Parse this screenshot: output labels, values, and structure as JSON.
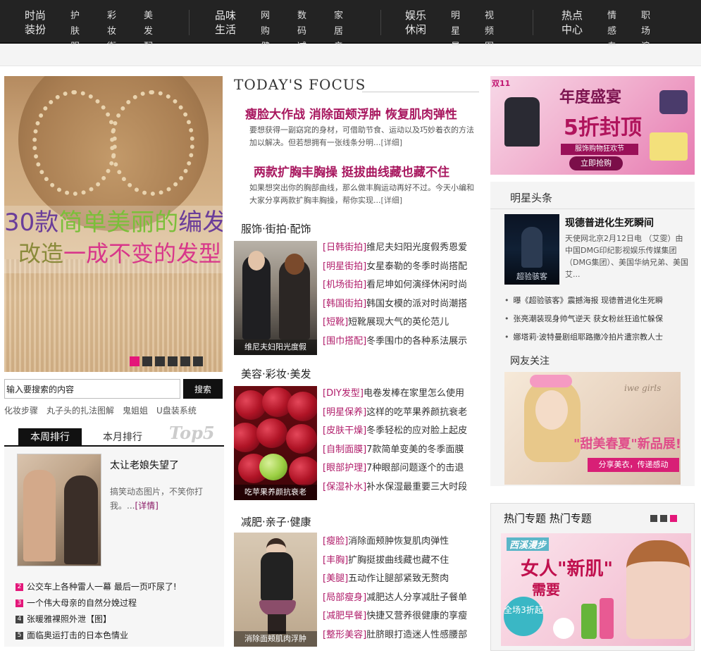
{
  "nav": [
    {
      "cat": [
        "时尚",
        "装扮"
      ],
      "subs": [
        [
          "护肤",
          "服饰"
        ],
        [
          "彩妆",
          "街拍"
        ],
        [
          "美发",
          "配饰"
        ]
      ]
    },
    {
      "cat": [
        "品味",
        "生活"
      ],
      "subs": [
        [
          "网购",
          "健康"
        ],
        [
          "数码",
          "减肥"
        ],
        [
          "家居",
          "亲子"
        ]
      ]
    },
    {
      "cat": [
        "娱乐",
        "休闲"
      ],
      "subs": [
        [
          "明星",
          "星座"
        ],
        [
          "视频",
          "图库"
        ]
      ]
    },
    {
      "cat": [
        "热点",
        "中心"
      ],
      "subs": [
        [
          "情感",
          "专题"
        ],
        [
          "职场",
          "浪漫"
        ]
      ]
    }
  ],
  "hero": {
    "line1": [
      "30款",
      "简单美丽的",
      "编发"
    ],
    "line2": [
      "改造",
      "一成不变的发型"
    ],
    "dots_count": 6,
    "active_dot": 0
  },
  "search": {
    "value": "输入要搜索的内容",
    "button": "搜索"
  },
  "hotwords": [
    "化妆步骤",
    "丸子头的扎法图解",
    "鬼姐姐",
    "U盘装系统"
  ],
  "rank": {
    "tab_week": "本周排行",
    "tab_month": "本月排行",
    "badge": "Top5",
    "featured_title": "太让老娘失望了",
    "featured_desc": "搞笑动态图片，不笑你打我。...",
    "featured_more": "[详情]",
    "items": [
      {
        "n": "2",
        "text": "公交车上各种雷人一幕 最后一页吓尿了!"
      },
      {
        "n": "3",
        "text": "一个伟大母亲的自然分娩过程"
      },
      {
        "n": "4",
        "text": "张暖雅裸照外泄【图】"
      },
      {
        "n": "5",
        "text": "面临奥运打击的日本色情业"
      }
    ]
  },
  "focus": {
    "title": "TODAY'S FOCUS",
    "items": [
      {
        "head": "瘦脸大作战 消除面颊浮肿 恢复肌肉弹性",
        "desc": "要想获得一副窈窕的身材，可借助节食、运动以及巧妙着衣的方法加以解决。但若想拥有一张线条分明...",
        "more": "[详细]"
      },
      {
        "head": "两款扩胸丰胸操 挺拔曲线藏也藏不住",
        "desc": "如果想突出你的胸部曲线，那么做丰胸运动再好不过。今天小编和大家分享两款扩胸丰胸操，帮你实现...",
        "more": "[详细]"
      }
    ]
  },
  "sections": [
    {
      "title": "服饰·街拍·配饰",
      "caption": "维尼夫妇阳光度假",
      "items": [
        {
          "tag": "[日韩街拍]",
          "text": "维尼夫妇阳光度假秀恩爱"
        },
        {
          "tag": "[明星街拍]",
          "text": "女星泰勒的冬季时尚搭配"
        },
        {
          "tag": "[机场街拍]",
          "text": "看尼坤如何演绎休闲时尚"
        },
        {
          "tag": "[韩国街拍]",
          "text": "韩国女模的派对时尚潮搭"
        },
        {
          "tag": "[短靴]",
          "text": "短靴展现大气的英伦范儿"
        },
        {
          "tag": "[围巾搭配]",
          "text": "冬季围巾的各种系法展示"
        }
      ]
    },
    {
      "title": "美容·彩妆·美发",
      "caption": "吃苹果养颜抗衰老",
      "items": [
        {
          "tag": "[DIY发型]",
          "text": "电卷发棒在家里怎么使用"
        },
        {
          "tag": "[明星保养]",
          "text": "这样的吃苹果养颜抗衰老"
        },
        {
          "tag": "[皮肤干燥]",
          "text": "冬季轻松的应对脸上起皮"
        },
        {
          "tag": "[自制面膜]",
          "text": "7款简单变美的冬季面膜"
        },
        {
          "tag": "[眼部护理]",
          "text": "7种眼部问题逐个的击退"
        },
        {
          "tag": "[保湿补水]",
          "text": "补水保湿最重要三大时段"
        }
      ]
    },
    {
      "title": "减肥·亲子·健康",
      "caption": "消除面颊肌肉浮肿",
      "items": [
        {
          "tag": "[瘦脸]",
          "text": "消除面颊肿恢复肌肉弹性"
        },
        {
          "tag": "[丰胸]",
          "text": "扩胸挺拔曲线藏也藏不住"
        },
        {
          "tag": "[美腿]",
          "text": "五动作让腿部紧致无赘肉"
        },
        {
          "tag": "[局部瘦身]",
          "text": "减肥达人分享减肚子餐单"
        },
        {
          "tag": "[减肥早餐]",
          "text": "快捷又营养很健康的享瘦"
        },
        {
          "tag": "[整形美容]",
          "text": "肚脐眼打造迷人性感腰部"
        }
      ]
    }
  ],
  "ad_top": {
    "badge": "双11",
    "title": "年度盛宴",
    "big": "5折封顶",
    "sub": "服饰购物狂欢节",
    "button": "立即抢购"
  },
  "stars": {
    "heading": "明星头条",
    "poster_text": "超验骇客",
    "title": "现德普进化生死瞬间",
    "desc": "天使网北京2月12日电 （艾雯）由中国DMG印纪影视娱乐传媒集团（DMG集团）、美国华纳兄弟、美国艾...",
    "items": [
      "曝《超验骇客》震撼海报 现德普进化生死瞬",
      "张亮潮装现身帅气逆天 获女粉丝狂追忙躲保",
      "娜塔莉·波特曼剧组耶路撒冷拍片遭宗教人士"
    ]
  },
  "netizen": {
    "heading": "网友关注",
    "brand": "iwe girls",
    "title": "\"甜美春夏\"新品展!",
    "sub": "分享美衣，传递感动"
  },
  "topics": {
    "heading": "热门专题  热门专题",
    "brand": "西溪漫步",
    "title": "女人\"新肌\"",
    "title2": "需要",
    "circle": "全场3折起"
  }
}
